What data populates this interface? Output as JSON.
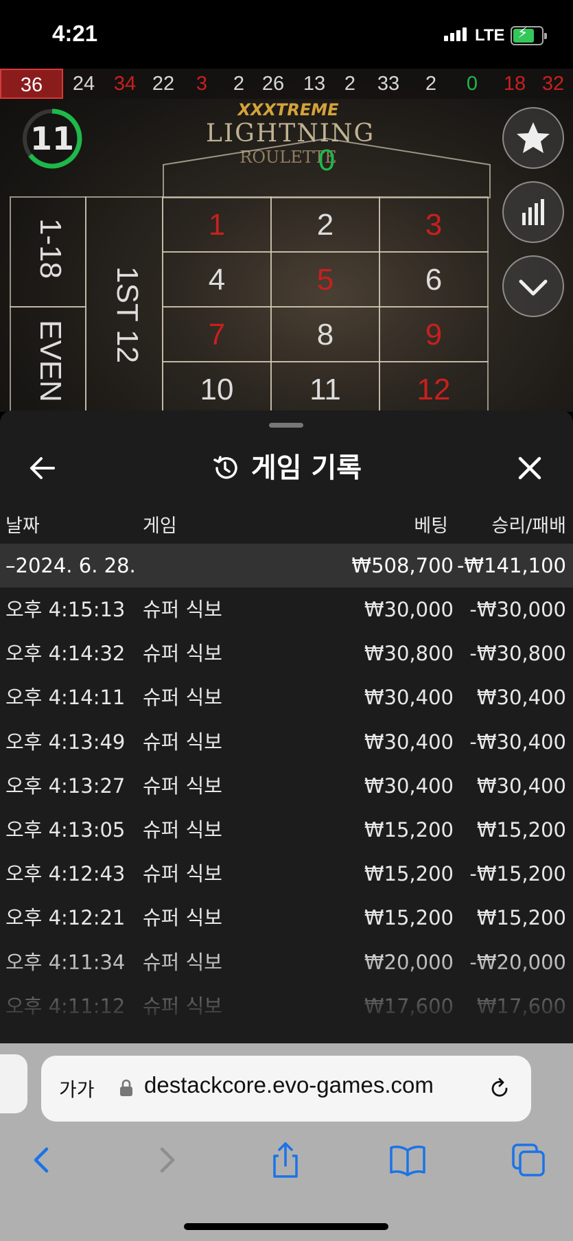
{
  "status_bar": {
    "time": "4:21",
    "network": "LTE"
  },
  "game": {
    "recent_results": [
      {
        "n": "36",
        "c": "red"
      },
      {
        "n": "24",
        "c": "black"
      },
      {
        "n": "34",
        "c": "red"
      },
      {
        "n": "22",
        "c": "black"
      },
      {
        "n": "3",
        "c": "red"
      },
      {
        "n": "2",
        "c": "black"
      },
      {
        "n": "26",
        "c": "black"
      },
      {
        "n": "13",
        "c": "black"
      },
      {
        "n": "2",
        "c": "black"
      },
      {
        "n": "33",
        "c": "black"
      },
      {
        "n": "2",
        "c": "black"
      },
      {
        "n": "0",
        "c": "green"
      },
      {
        "n": "18",
        "c": "red"
      },
      {
        "n": "32",
        "c": "red"
      }
    ],
    "logo_line1": "XXXTREME",
    "logo_line2": "LIGHTNING",
    "logo_line3": "ROULETTE",
    "timer": "11",
    "zero_label": "0",
    "outside_bet_1": "1-18",
    "outside_bet_2": "EVEN",
    "dozen_label": "1ST 12",
    "numbers": [
      "1",
      "2",
      "3",
      "4",
      "5",
      "6",
      "7",
      "8",
      "9",
      "10",
      "11",
      "12"
    ]
  },
  "history": {
    "title": "게임 기록",
    "columns": {
      "date": "날짜",
      "game": "게임",
      "bet": "베팅",
      "win_loss": "승리/패배"
    },
    "date_group": {
      "date": "–2024. 6. 28.",
      "bet": "₩508,700",
      "win_loss": "-₩141,100"
    },
    "rows": [
      {
        "time": "오후 4:15:13",
        "game": "슈퍼 식보",
        "bet": "₩30,000",
        "result": "-₩30,000"
      },
      {
        "time": "오후 4:14:32",
        "game": "슈퍼 식보",
        "bet": "₩30,800",
        "result": "-₩30,800"
      },
      {
        "time": "오후 4:14:11",
        "game": "슈퍼 식보",
        "bet": "₩30,400",
        "result": "₩30,400"
      },
      {
        "time": "오후 4:13:49",
        "game": "슈퍼 식보",
        "bet": "₩30,400",
        "result": "-₩30,400"
      },
      {
        "time": "오후 4:13:27",
        "game": "슈퍼 식보",
        "bet": "₩30,400",
        "result": "₩30,400"
      },
      {
        "time": "오후 4:13:05",
        "game": "슈퍼 식보",
        "bet": "₩15,200",
        "result": "₩15,200"
      },
      {
        "time": "오후 4:12:43",
        "game": "슈퍼 식보",
        "bet": "₩15,200",
        "result": "-₩15,200"
      },
      {
        "time": "오후 4:12:21",
        "game": "슈퍼 식보",
        "bet": "₩15,200",
        "result": "₩15,200"
      },
      {
        "time": "오후 4:11:34",
        "game": "슈퍼 식보",
        "bet": "₩20,000",
        "result": "-₩20,000"
      },
      {
        "time": "오후 4:11:12",
        "game": "슈퍼 식보",
        "bet": "₩17,600",
        "result": "₩17,600"
      }
    ]
  },
  "browser": {
    "text_size_label": "가가",
    "url": "destackcore.evo-games.com"
  },
  "colors": {
    "accent_red": "#c8201e",
    "timer_green": "#1fb84a",
    "link_blue": "#1a73e8"
  }
}
